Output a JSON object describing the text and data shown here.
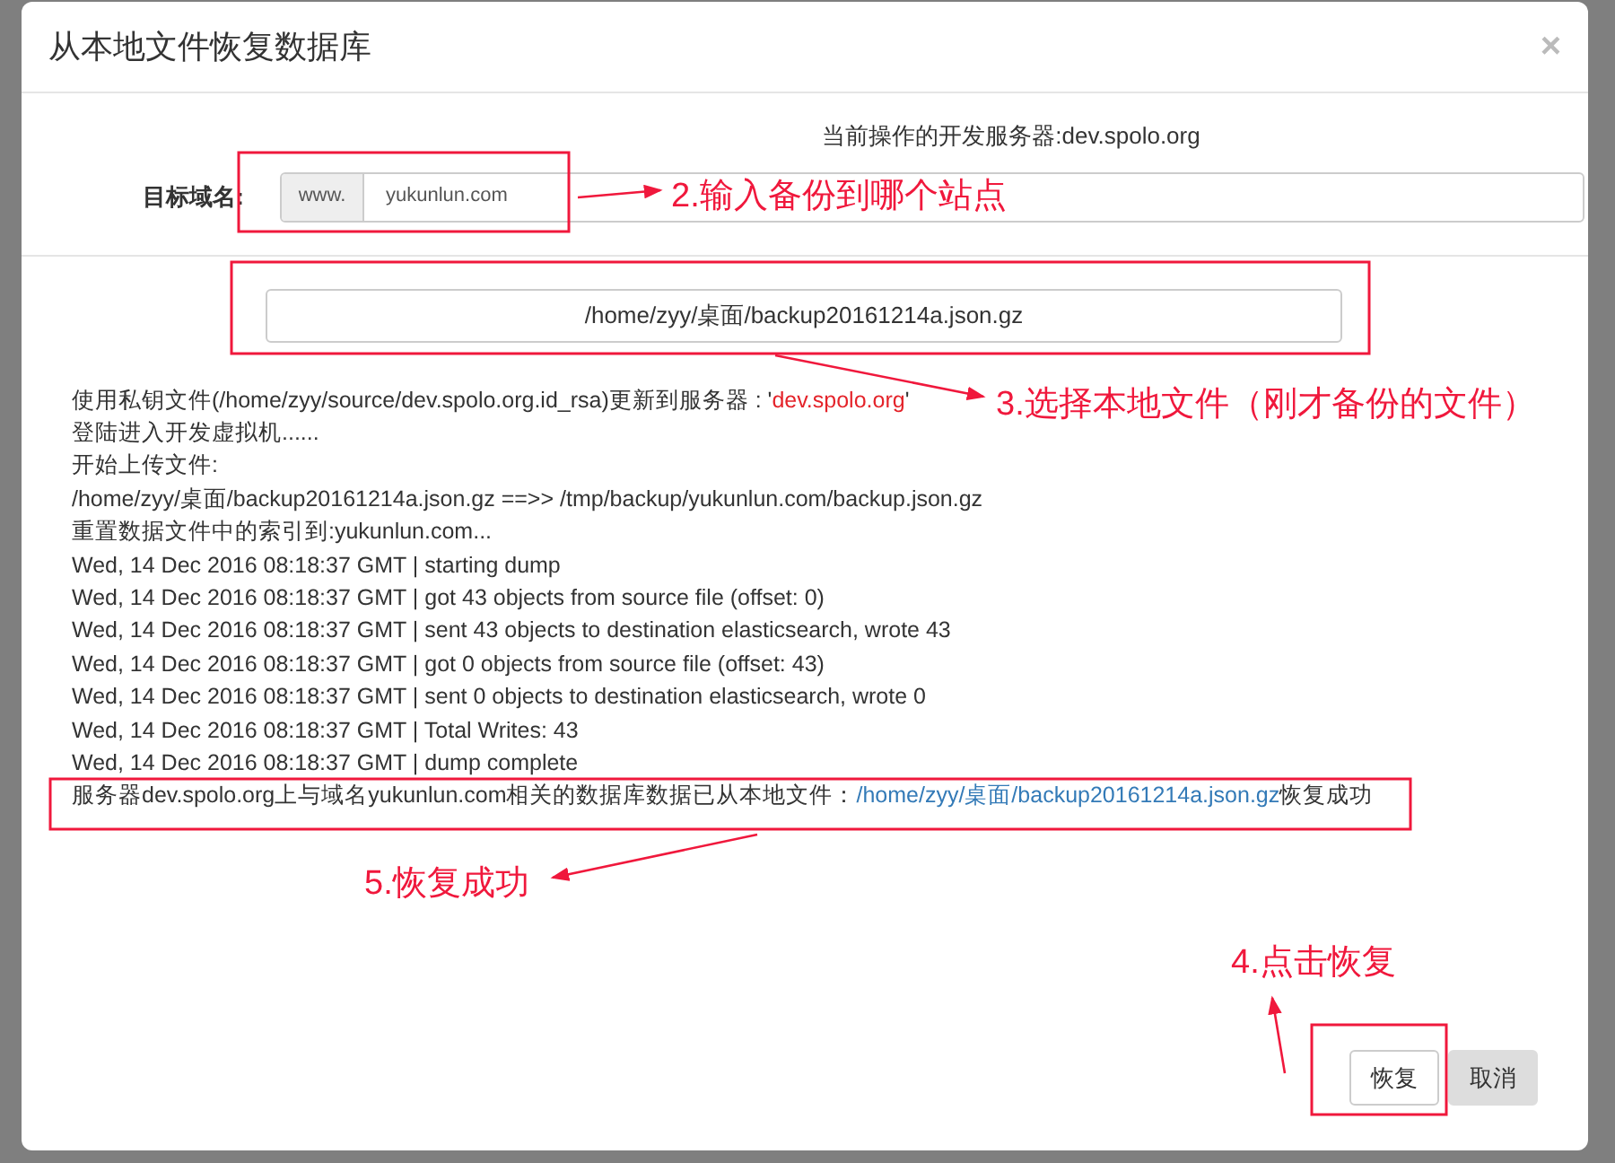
{
  "dialog": {
    "title": "从本地文件恢复数据库",
    "close": "×"
  },
  "server_line": "当前操作的开发服务器:dev.spolo.org",
  "domain": {
    "label": "目标域名:",
    "prefix": "www.",
    "value": "yukunlun.com"
  },
  "file_button": "/home/zyy/桌面/backup20161214a.json.gz",
  "log": [
    {
      "segments": [
        {
          "kind": "plain",
          "text": "使用私钥文件(/home/zyy/source/dev.spolo.org.id_rsa)更新到服务器 : '"
        },
        {
          "kind": "server",
          "text": "dev.spolo.org"
        },
        {
          "kind": "plain",
          "text": "'"
        }
      ]
    },
    {
      "segments": [
        {
          "kind": "plain",
          "text": "登陆进入开发虚拟机......"
        }
      ]
    },
    {
      "segments": [
        {
          "kind": "plain",
          "text": "开始上传文件:"
        }
      ]
    },
    {
      "segments": [
        {
          "kind": "plain",
          "text": "/home/zyy/桌面/backup20161214a.json.gz ==>> /tmp/backup/yukunlun.com/backup.json.gz"
        }
      ]
    },
    {
      "segments": [
        {
          "kind": "plain",
          "text": "重置数据文件中的索引到:yukunlun.com..."
        }
      ]
    },
    {
      "segments": [
        {
          "kind": "plain",
          "text": "Wed, 14 Dec 2016 08:18:37 GMT | starting dump"
        }
      ]
    },
    {
      "segments": [
        {
          "kind": "plain",
          "text": "Wed, 14 Dec 2016 08:18:37 GMT | got 43 objects from source file (offset: 0)"
        }
      ]
    },
    {
      "segments": [
        {
          "kind": "plain",
          "text": "Wed, 14 Dec 2016 08:18:37 GMT | sent 43 objects to destination elasticsearch, wrote 43"
        }
      ]
    },
    {
      "segments": [
        {
          "kind": "plain",
          "text": "Wed, 14 Dec 2016 08:18:37 GMT | got 0 objects from source file (offset: 43)"
        }
      ]
    },
    {
      "segments": [
        {
          "kind": "plain",
          "text": "Wed, 14 Dec 2016 08:18:37 GMT | sent 0 objects to destination elasticsearch, wrote 0"
        }
      ]
    },
    {
      "segments": [
        {
          "kind": "plain",
          "text": "Wed, 14 Dec 2016 08:18:37 GMT | Total Writes: 43"
        }
      ]
    },
    {
      "segments": [
        {
          "kind": "plain",
          "text": "Wed, 14 Dec 2016 08:18:37 GMT | dump complete"
        }
      ]
    },
    {
      "segments": [
        {
          "kind": "plain",
          "text": "服务器dev.spolo.org上与域名yukunlun.com相关的数据库数据已从本地文件："
        },
        {
          "kind": "link",
          "text": "/home/zyy/桌面/backup20161214a.json.gz"
        },
        {
          "kind": "plain",
          "text": "恢复成功"
        }
      ]
    }
  ],
  "buttons": [
    {
      "label": "恢复",
      "kind": "default"
    },
    {
      "label": "取消",
      "kind": "muted"
    }
  ],
  "annotations": [
    "2.输入备份到哪个站点",
    "3.选择本地文件（刚才备份的文件）",
    "5.恢复成功",
    "4.点击恢复"
  ]
}
